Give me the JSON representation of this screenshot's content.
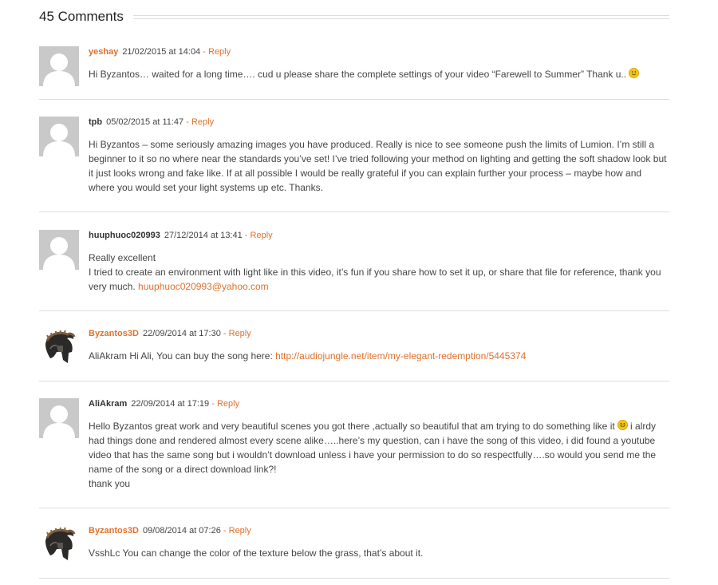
{
  "header": {
    "title": "45 Comments"
  },
  "comments": [
    {
      "author": "yeshay",
      "author_is_admin": false,
      "date": "21/02/2015 at 14:04",
      "separator": " - ",
      "reply_label": "Reply",
      "avatar_icon": "default-avatar-icon",
      "lines": [
        "Hi Byzantos… waited for a long time…. cud u please share the complete settings of your video “Farewell to Summer” Thank u.."
      ],
      "trailing_icon": "smiley-icon"
    },
    {
      "author": "tpb",
      "author_is_admin": false,
      "date": "05/02/2015 at 11:47",
      "separator": " - ",
      "reply_label": "Reply",
      "avatar_icon": "default-avatar-icon",
      "lines": [
        "Hi Byzantos – some seriously amazing images you have produced. Really is nice to see someone push the limits of Lumion. I’m still a beginner to it so no where near the standards you’ve set! I’ve tried following your method on lighting and getting the soft shadow look but it just looks wrong and fake like. If at all possible I would be really grateful if you can explain further your process – maybe how and where you would set your light systems up  etc. Thanks."
      ]
    },
    {
      "author": "huuphuoc020993",
      "author_is_admin": false,
      "date": "27/12/2014 at 13:41",
      "separator": " - ",
      "reply_label": "Reply",
      "avatar_icon": "default-avatar-icon",
      "lines": [
        "Really excellent",
        "I tried to create an environment with light like in this video, it’s fun if you share how to set it up, or share that file for reference, thank you very much."
      ],
      "email": "huuphuoc020993@yahoo.com"
    },
    {
      "author": "Byzantos3D",
      "author_is_admin": true,
      "date": "22/09/2014 at 17:30",
      "separator": " - ",
      "reply_label": "Reply",
      "avatar_icon": "spartan-helmet-icon",
      "text_before_link": "AliAkram Hi Ali, You can buy the song here: ",
      "link": "http://audiojungle.net/item/my-elegant-redemption/5445374"
    },
    {
      "author": "AliAkram",
      "author_is_admin": false,
      "date": "22/09/2014 at 17:19",
      "separator": " - ",
      "reply_label": "Reply",
      "avatar_icon": "default-avatar-icon",
      "text_before_smiley": "Hello Byzantos great work and very beautiful scenes you got there ,actually so beautiful that am trying to do something like it",
      "inline_icon": "grin-icon",
      "text_after_smiley": " i alrdy had things done and rendered almost every scene alike…..here’s my question, can i have the song of this video, i did found a youtube video that has the same song but i wouldn’t download unless i have your permission to do so respectfully….so would you send me the name of the song or a direct download link?!",
      "closing": "thank you"
    },
    {
      "author": "Byzantos3D",
      "author_is_admin": true,
      "date": "09/08/2014 at 07:26",
      "separator": " - ",
      "reply_label": "Reply",
      "avatar_icon": "spartan-helmet-icon",
      "lines": [
        "VsshLc You can change the color of the texture below the grass, that’s about it."
      ]
    }
  ],
  "colors": {
    "accent": "#e0712c",
    "text": "#444444",
    "divider": "#dddddd",
    "avatar_bg": "#c9c9c9"
  }
}
